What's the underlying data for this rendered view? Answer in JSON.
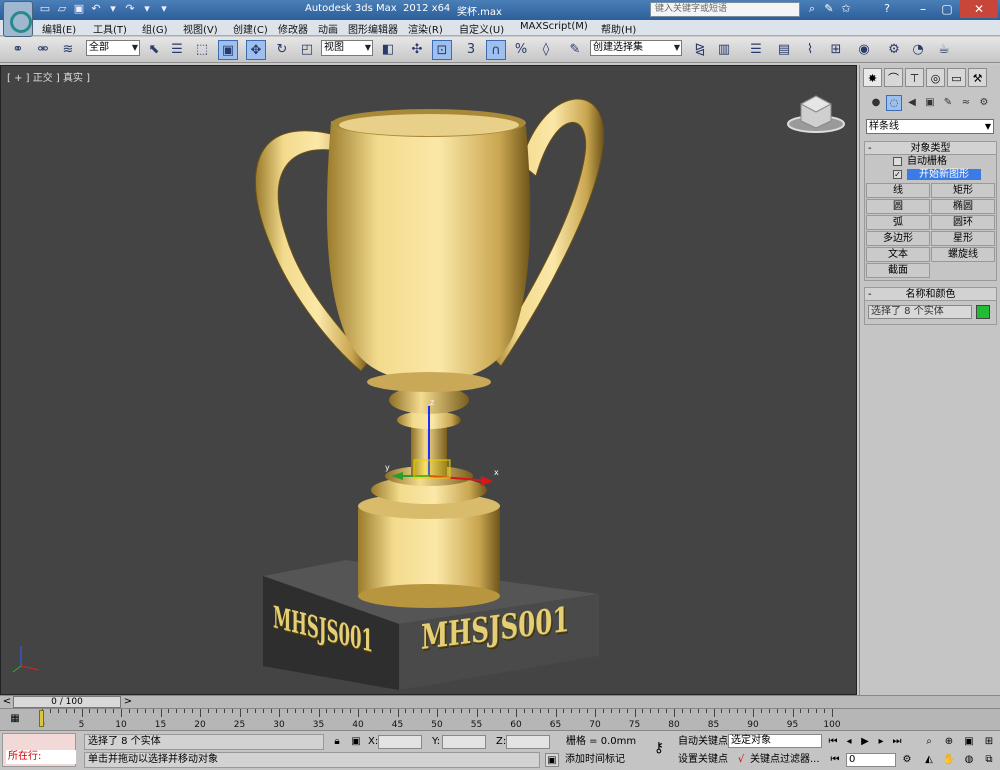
{
  "titlebar": {
    "app_title": "Autodesk 3ds Max  2012 x64",
    "file_name": "奖杯.max",
    "search_placeholder": "键入关键字或短语",
    "quick_access_icons": [
      "new-file-icon",
      "open-file-icon",
      "save-icon",
      "undo-icon",
      "redo-icon",
      "dropdown-icon"
    ]
  },
  "menu": {
    "items": [
      "编辑(E)",
      "工具(T)",
      "组(G)",
      "视图(V)",
      "创建(C)",
      "修改器",
      "动画",
      "图形编辑器",
      "渲染(R)",
      "自定义(U)",
      "MAXScript(M)",
      "帮助(H)"
    ]
  },
  "toolbar": {
    "selection_filter": "全部",
    "reference_coord": "视图",
    "snap_label": "3",
    "named_selection": "创建选择集"
  },
  "viewport": {
    "label": "[ + ] 正交 ] 真实 ]",
    "base_text_left": "MHSJS001",
    "base_text_right": "MHSJS001",
    "gizmo_x": "x",
    "gizmo_y": "y",
    "gizmo_z": "z"
  },
  "command_panel": {
    "category": "样条线",
    "object_type": {
      "title": "对象类型",
      "auto_grid": "自动栅格",
      "start_new_shape": "开始新图形",
      "buttons": [
        "线",
        "矩形",
        "圆",
        "椭圆",
        "弧",
        "圆环",
        "多边形",
        "星形",
        "文本",
        "螺旋线",
        "截面"
      ]
    },
    "name_color": {
      "title": "名称和颜色",
      "name_value": "选择了 8 个实体",
      "color": "#22bb33"
    }
  },
  "timeline": {
    "frame_display": "0 / 100",
    "ticks": [
      "0",
      "5",
      "10",
      "15",
      "20",
      "25",
      "30",
      "35",
      "40",
      "45",
      "50",
      "55",
      "60",
      "65",
      "70",
      "75",
      "80",
      "85",
      "90",
      "95",
      "100"
    ]
  },
  "status": {
    "script_label": "所在行:",
    "selection_info": "选择了 8 个实体",
    "prompt": "单击并拖动以选择并移动对象",
    "x_label": "X:",
    "y_label": "Y:",
    "z_label": "Z:",
    "grid": "栅格 = 0.0mm",
    "add_time_tag": "添加时间标记",
    "auto_key": "自动关键点",
    "set_key": "设置关键点",
    "selected_object": "选定对象",
    "key_filters": "关键点过滤器...",
    "frame_value": "0"
  },
  "colors": {
    "viewport_bg": "#444444",
    "trophy_gold": "#e2c77a",
    "accent_blue": "#3b7be6"
  }
}
